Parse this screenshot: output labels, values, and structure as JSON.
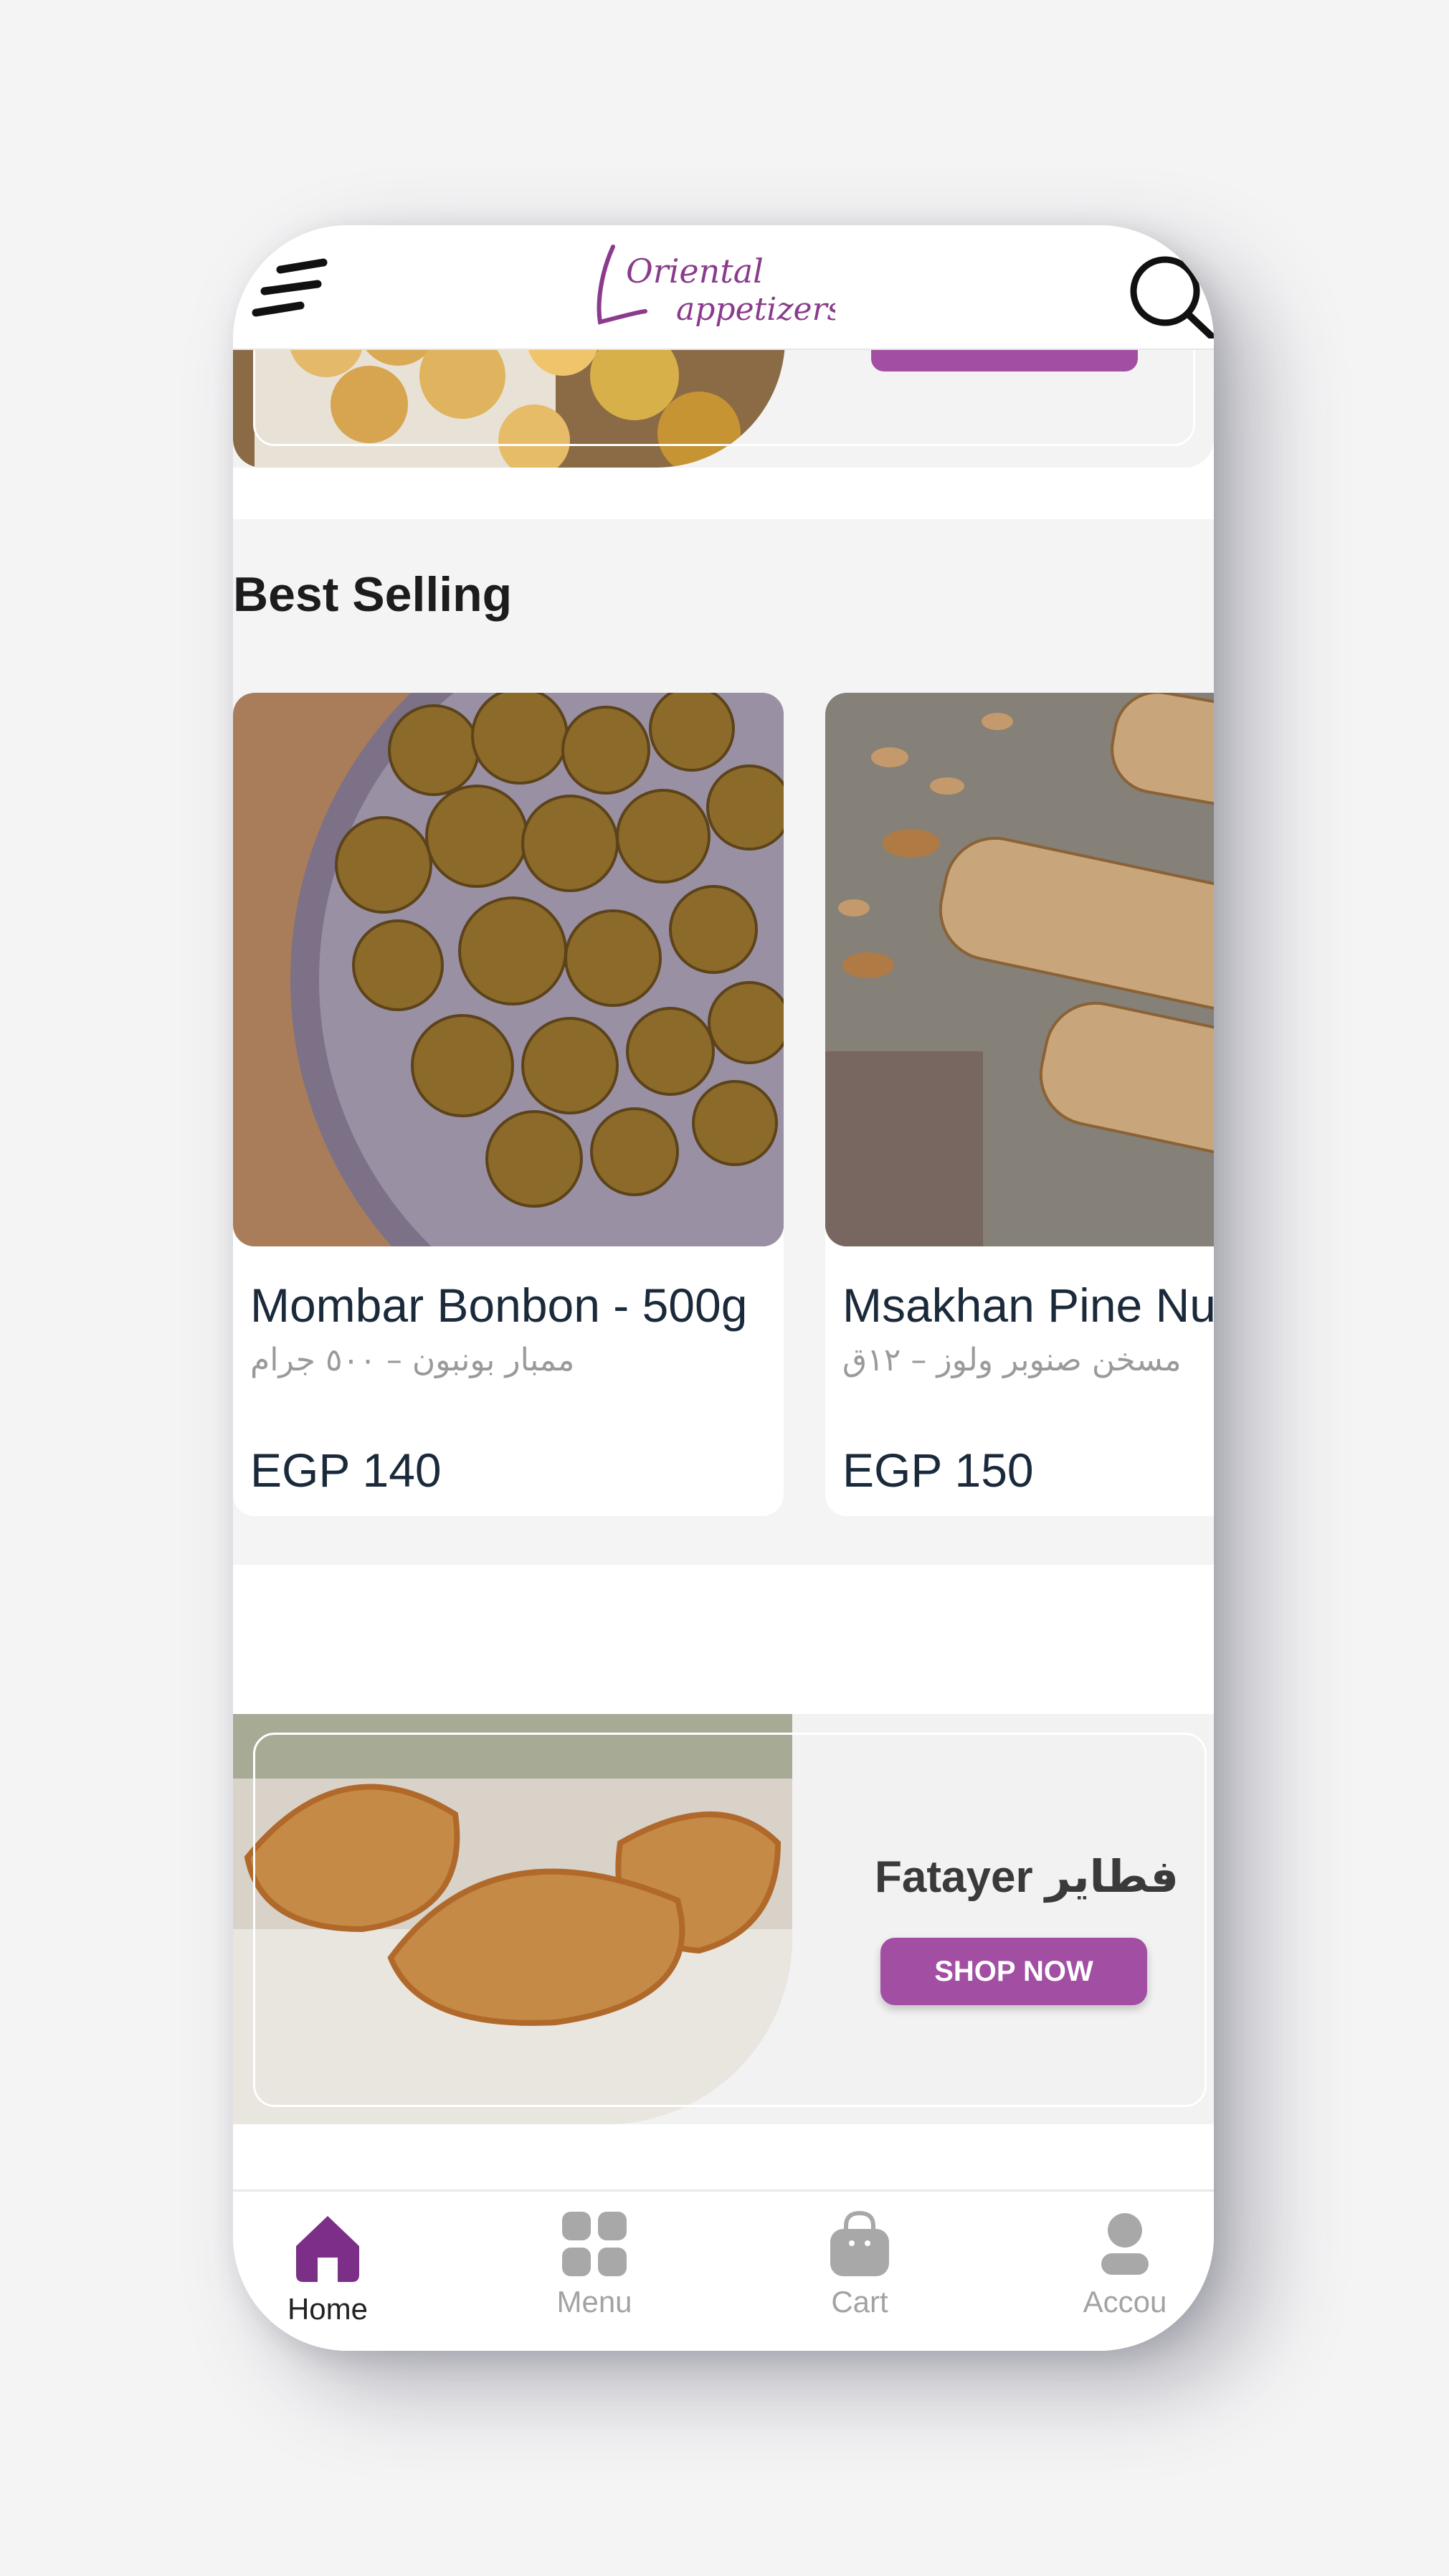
{
  "header": {
    "logo_text_line1": "Oriental",
    "logo_text_line2": "appetizers"
  },
  "best_selling": {
    "title": "Best Selling",
    "products": [
      {
        "name": "Mombar Bonbon - 500g",
        "name_ar": "ممبار بونبون – ٥٠٠ جرام",
        "price": "EGP 140"
      },
      {
        "name": "Msakhan Pine Nu",
        "name_ar": "مسخن صنوبر ولوز – ١٢ق",
        "price": "EGP 150"
      }
    ]
  },
  "promo": {
    "title": "Fatayer فطاير",
    "button": "SHOP NOW"
  },
  "tabbar": {
    "tabs": [
      {
        "label": "Home",
        "active": true
      },
      {
        "label": "Menu",
        "active": false
      },
      {
        "label": "Cart",
        "active": false
      },
      {
        "label": "Accou",
        "active": false
      }
    ]
  },
  "colors": {
    "accent": "#a24fa3",
    "active_icon": "#7b2f86",
    "text_dark": "#1b2a3a",
    "muted": "#a3a3a3"
  }
}
